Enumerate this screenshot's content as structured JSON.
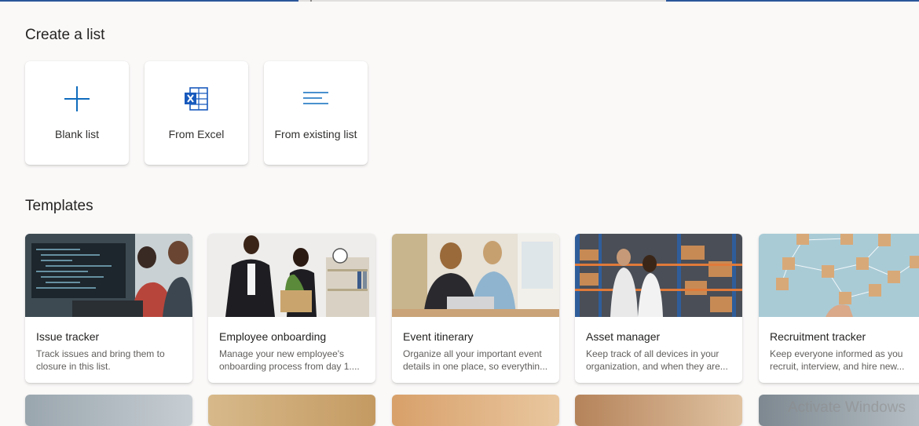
{
  "create": {
    "heading": "Create a list",
    "options": [
      {
        "label": "Blank list",
        "icon": "plus-icon"
      },
      {
        "label": "From Excel",
        "icon": "excel-icon"
      },
      {
        "label": "From existing list",
        "icon": "list-lines-icon"
      }
    ]
  },
  "templates": {
    "heading": "Templates",
    "items": [
      {
        "title": "Issue tracker",
        "desc_line1": "Track issues and bring them to",
        "desc_line2": "closure in this list."
      },
      {
        "title": "Employee onboarding",
        "desc_line1": "Manage your new employee's",
        "desc_line2": "onboarding process from day 1...."
      },
      {
        "title": "Event itinerary",
        "desc_line1": "Organize all your important event",
        "desc_line2": "details in one place, so everythin..."
      },
      {
        "title": "Asset manager",
        "desc_line1": "Keep track of all devices in your",
        "desc_line2": "organization, and when they are..."
      },
      {
        "title": "Recruitment tracker",
        "desc_line1": "Keep everyone informed as you",
        "desc_line2": "recruit, interview, and hire new..."
      }
    ]
  },
  "colors": {
    "accent": "#0f6cbd",
    "excel": "#185abd",
    "page_bg": "#faf9f8"
  },
  "watermark": "Activate Windows"
}
